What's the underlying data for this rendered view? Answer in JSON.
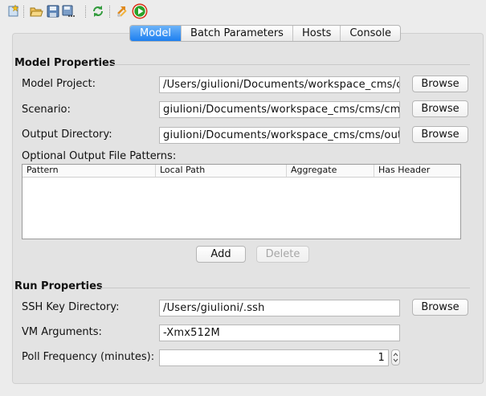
{
  "toolbar": {
    "icons": [
      "new-document-icon",
      "open-folder-icon",
      "save-icon",
      "save-as-icon",
      "refresh-icon",
      "arrows-icon",
      "run-icon"
    ]
  },
  "tabs": [
    {
      "label": "Model",
      "active": true
    },
    {
      "label": "Batch Parameters",
      "active": false
    },
    {
      "label": "Hosts",
      "active": false
    },
    {
      "label": "Console",
      "active": false
    }
  ],
  "model_properties": {
    "title": "Model Properties",
    "model_project_label": "Model Project:",
    "model_project_value": "/Users/giulioni/Documents/workspace_cms/cms",
    "scenario_label": "Scenario:",
    "scenario_value": "giulioni/Documents/workspace_cms/cms/cms.rs",
    "output_dir_label": "Output Directory:",
    "output_dir_value": "giulioni/Documents/workspace_cms/cms/output",
    "browse_label": "Browse",
    "patterns_label": "Optional Output File Patterns:",
    "columns": [
      "Pattern",
      "Local Path",
      "Aggregate",
      "Has Header"
    ],
    "add_label": "Add",
    "delete_label": "Delete"
  },
  "run_properties": {
    "title": "Run Properties",
    "ssh_label": "SSH Key Directory:",
    "ssh_value": "/Users/giulioni/.ssh",
    "browse_label": "Browse",
    "vm_label": "VM Arguments:",
    "vm_value": "-Xmx512M",
    "poll_label": "Poll Frequency (minutes):",
    "poll_value": "1"
  },
  "colors": {
    "accent": "#1d7ff0",
    "run": "#2aa22a",
    "run_ring": "#d8331b"
  }
}
